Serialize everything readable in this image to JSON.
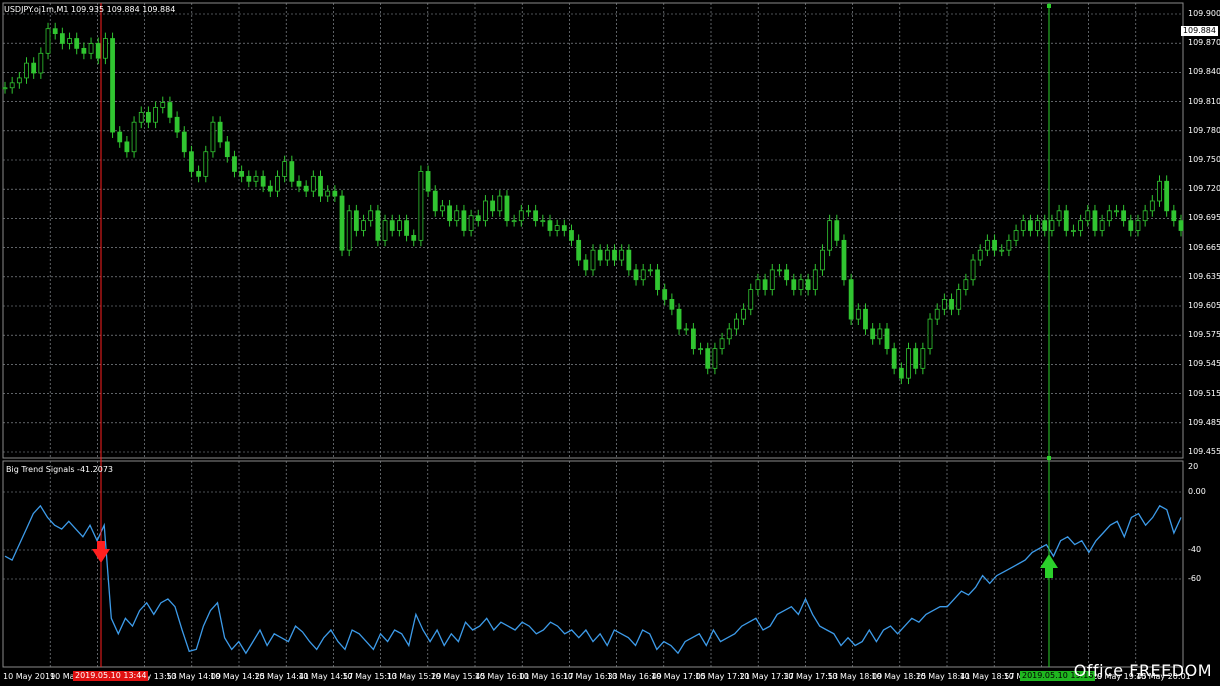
{
  "header": {
    "symbol_line": "USDJPY.oj1m,M1  109.935 109.884 109.884",
    "indicator_line": "Big Trend Signals -41.2073"
  },
  "price_axis": {
    "ticks": [
      "109.900",
      "109.870",
      "109.840",
      "109.810",
      "109.780",
      "109.750",
      "109.720",
      "109.695",
      "109.665",
      "109.635",
      "109.605",
      "109.575",
      "109.545",
      "109.515",
      "109.485",
      "109.455"
    ],
    "current_price": "109.884"
  },
  "indicator_axis": {
    "ticks": [
      "20",
      "0.00",
      "-40",
      "-60"
    ]
  },
  "time_axis": {
    "labels": [
      "10 May 2019",
      "10 May",
      "10 May 13:53",
      "10 May 14:09",
      "10 May 14:25",
      "10 May 14:41",
      "10 May 14:57",
      "10 May 15:13",
      "10 May 15:29",
      "10 May 15:45",
      "10 May 16:01",
      "10 May 16:17",
      "10 May 16:33",
      "10 May 16:49",
      "10 May 17:05",
      "10 May 17:21",
      "10 May 17:37",
      "10 May 17:53",
      "10 May 18:09",
      "10 May 18:25",
      "10 May 18:41",
      "10 May 18:57",
      "10 May 19:13",
      "10 May 19:29",
      "10 May 19:45",
      "10 May 20:01"
    ],
    "sell_marker_time": "2019.05.10 13:44",
    "buy_marker_time": "2019.05.10 19:16"
  },
  "watermark": "Office FREEDOM",
  "colors": {
    "background": "#000000",
    "grid": "#9aa0a6",
    "candles": "#31c531",
    "indicator_line": "#3d9be9",
    "sell": "#ff1f1f",
    "buy": "#2bd02b"
  },
  "chart_data": [
    {
      "type": "line",
      "title": "USDJPY.oj1m,M1",
      "ylim": [
        109.455,
        109.905
      ],
      "series": [
        {
          "name": "USDJPY.oj1m,M1",
          "values": [
            109.825,
            109.83,
            109.835,
            109.85,
            109.84,
            109.86,
            109.885,
            109.88,
            109.87,
            109.875,
            109.865,
            109.86,
            109.87,
            109.855,
            109.875,
            109.78,
            109.77,
            109.76,
            109.79,
            109.8,
            109.79,
            109.805,
            109.81,
            109.795,
            109.78,
            109.76,
            109.74,
            109.735,
            109.76,
            109.79,
            109.77,
            109.755,
            109.74,
            109.735,
            109.73,
            109.735,
            109.725,
            109.72,
            109.735,
            109.75,
            109.73,
            109.725,
            109.72,
            109.735,
            109.715,
            109.72,
            109.715,
            109.66,
            109.7,
            109.68,
            109.69,
            109.7,
            109.67,
            109.69,
            109.68,
            109.69,
            109.675,
            109.67,
            109.74,
            109.72,
            109.7,
            109.705,
            109.69,
            109.7,
            109.68,
            109.695,
            109.69,
            109.71,
            109.7,
            109.715,
            109.69,
            109.69,
            109.7,
            109.7,
            109.69,
            109.69,
            109.68,
            109.685,
            109.68,
            109.67,
            109.65,
            109.64,
            109.66,
            109.65,
            109.66,
            109.65,
            109.66,
            109.64,
            109.63,
            109.64,
            109.64,
            109.62,
            109.61,
            109.6,
            109.58,
            109.58,
            109.56,
            109.56,
            109.54,
            109.56,
            109.57,
            109.58,
            109.59,
            109.6,
            109.62,
            109.63,
            109.62,
            109.64,
            109.64,
            109.63,
            109.62,
            109.63,
            109.62,
            109.64,
            109.66,
            109.69,
            109.67,
            109.63,
            109.59,
            109.6,
            109.58,
            109.57,
            109.58,
            109.56,
            109.54,
            109.53,
            109.56,
            109.54,
            109.56,
            109.59,
            109.6,
            109.61,
            109.6,
            109.62,
            109.63,
            109.65,
            109.66,
            109.67,
            109.66,
            109.66,
            109.67,
            109.68,
            109.69,
            109.68,
            109.69,
            109.68,
            109.69,
            109.7,
            109.68,
            109.68,
            109.69,
            109.7,
            109.68,
            109.69,
            109.7,
            109.7,
            109.69,
            109.68,
            109.69,
            109.7,
            109.71,
            109.73,
            109.7,
            109.69,
            109.68
          ]
        }
      ]
    },
    {
      "type": "line",
      "title": "Big Trend Signals -41.2073",
      "ylim": [
        -80,
        20
      ],
      "series": [
        {
          "name": "Big Trend Signals",
          "values": [
            -26,
            -28,
            -20,
            -12,
            -4,
            0,
            -6,
            -10,
            -12,
            -8,
            -12,
            -16,
            -10,
            -18,
            -10,
            -58,
            -66,
            -58,
            -62,
            -54,
            -50,
            -56,
            -50,
            -48,
            -52,
            -64,
            -75,
            -74,
            -62,
            -54,
            -50,
            -68,
            -74,
            -70,
            -76,
            -70,
            -64,
            -72,
            -66,
            -68,
            -70,
            -62,
            -65,
            -70,
            -74,
            -68,
            -64,
            -70,
            -74,
            -64,
            -66,
            -70,
            -74,
            -66,
            -70,
            -64,
            -66,
            -72,
            -56,
            -64,
            -70,
            -64,
            -72,
            -66,
            -70,
            -60,
            -64,
            -62,
            -58,
            -64,
            -60,
            -62,
            -64,
            -60,
            -62,
            -66,
            -64,
            -60,
            -62,
            -66,
            -64,
            -68,
            -64,
            -70,
            -66,
            -72,
            -64,
            -66,
            -68,
            -72,
            -64,
            -66,
            -74,
            -70,
            -72,
            -76,
            -70,
            -68,
            -66,
            -72,
            -64,
            -70,
            -68,
            -66,
            -62,
            -60,
            -58,
            -64,
            -62,
            -56,
            -54,
            -52,
            -56,
            -48,
            -56,
            -62,
            -64,
            -66,
            -72,
            -68,
            -72,
            -70,
            -64,
            -70,
            -64,
            -62,
            -66,
            -62,
            -58,
            -60,
            -56,
            -54,
            -52,
            -52,
            -48,
            -44,
            -46,
            -42,
            -36,
            -40,
            -36,
            -34,
            -32,
            -30,
            -28,
            -24,
            -22,
            -20,
            -26,
            -18,
            -16,
            -20,
            -18,
            -24,
            -18,
            -14,
            -10,
            -8,
            -16,
            -6,
            -4,
            -10,
            -6,
            0,
            -2,
            -14,
            -6
          ]
        }
      ]
    }
  ]
}
